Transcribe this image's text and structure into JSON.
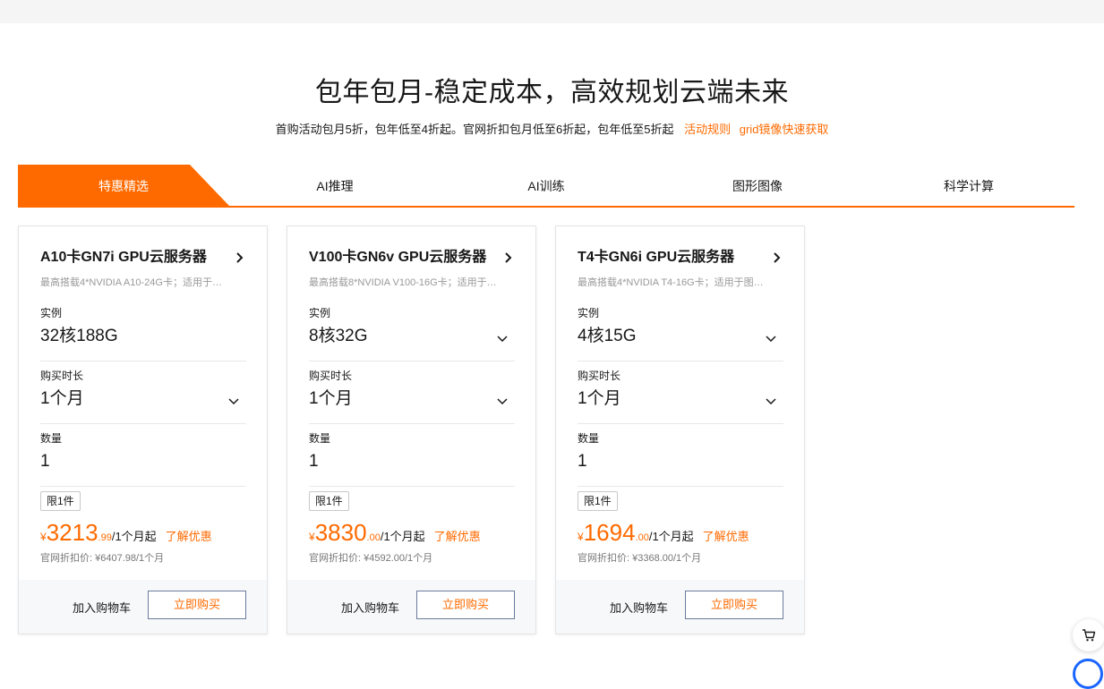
{
  "header": {
    "title": "包年包月-稳定成本，高效规划云端未来",
    "promo_text": "首购活动包月5折，包年低至4折起。官网折扣包月低至6折起，包年低至5折起",
    "promo_links": [
      "活动规则",
      "grid镜像快速获取"
    ]
  },
  "tabs": [
    {
      "label": "特惠精选",
      "active": true
    },
    {
      "label": "AI推理",
      "active": false
    },
    {
      "label": "AI训练",
      "active": false
    },
    {
      "label": "图形图像",
      "active": false
    },
    {
      "label": "科学计算",
      "active": false
    }
  ],
  "colors": {
    "accent": "#ff6a00",
    "button_border": "#6c7a9b"
  },
  "cards": [
    {
      "title": "A10卡GN7i GPU云服务器",
      "desc": "最高搭载4*NVIDIA A10-24G卡；适用于…",
      "instance_label": "实例",
      "instance_value": "32核188G",
      "instance_dropdown": false,
      "duration_label": "购买时长",
      "duration_value": "1个月",
      "qty_label": "数量",
      "qty_value": "1",
      "limit_tag": "限1件",
      "currency": "¥",
      "price_int": "3213",
      "price_dec": ".99",
      "price_unit": "/1个月起",
      "offer_link": "了解优惠",
      "orig_price": "官网折扣价: ¥6407.98/1个月",
      "cart_label": "加入购物车",
      "buy_label": "立即购买"
    },
    {
      "title": "V100卡GN6v GPU云服务器",
      "desc": "最高搭载8*NVIDIA V100-16G卡；适用于…",
      "instance_label": "实例",
      "instance_value": "8核32G",
      "instance_dropdown": true,
      "duration_label": "购买时长",
      "duration_value": "1个月",
      "qty_label": "数量",
      "qty_value": "1",
      "limit_tag": "限1件",
      "currency": "¥",
      "price_int": "3830",
      "price_dec": ".00",
      "price_unit": "/1个月起",
      "offer_link": "了解优惠",
      "orig_price": "官网折扣价: ¥4592.00/1个月",
      "cart_label": "加入购物车",
      "buy_label": "立即购买"
    },
    {
      "title": "T4卡GN6i GPU云服务器",
      "desc": "最高搭载4*NVIDIA T4-16G卡；适用于图…",
      "instance_label": "实例",
      "instance_value": "4核15G",
      "instance_dropdown": true,
      "duration_label": "购买时长",
      "duration_value": "1个月",
      "qty_label": "数量",
      "qty_value": "1",
      "limit_tag": "限1件",
      "currency": "¥",
      "price_int": "1694",
      "price_dec": ".00",
      "price_unit": "/1个月起",
      "offer_link": "了解优惠",
      "orig_price": "官网折扣价: ¥3368.00/1个月",
      "cart_label": "加入购物车",
      "buy_label": "立即购买"
    }
  ],
  "floating": {
    "cart_icon": "shopping-cart-icon",
    "help_icon": "service-icon"
  }
}
